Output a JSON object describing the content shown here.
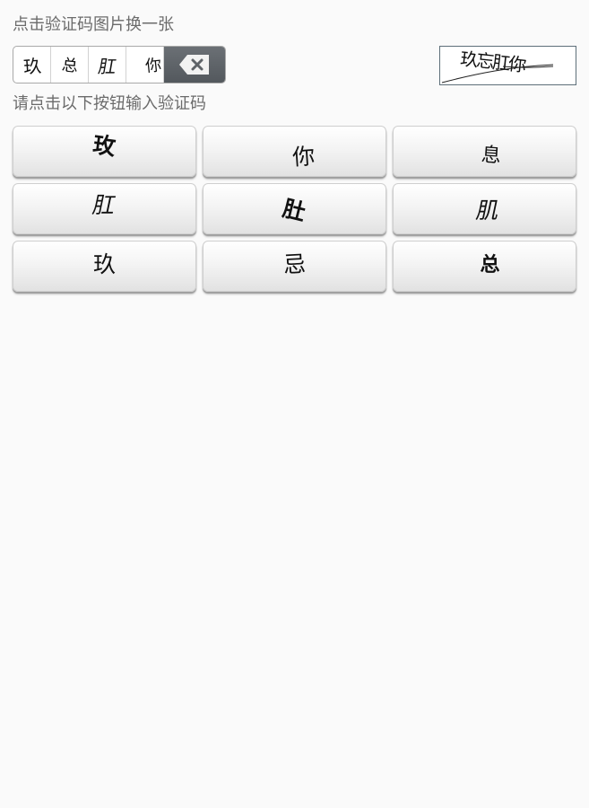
{
  "hints": {
    "refresh": "点击验证码图片换一张",
    "select": "请点击以下按钮输入验证码"
  },
  "entry": {
    "chars": [
      "玖",
      "总",
      "肛",
      "你"
    ],
    "backspace_icon": "backspace-icon"
  },
  "captcha": {
    "text": "玖忘肛你"
  },
  "keys": [
    "玫",
    "你",
    "息",
    "肛",
    "肚",
    "肌",
    "玖",
    "忌",
    "总"
  ],
  "colors": {
    "background": "#fafafa",
    "hint": "#6b6b6b",
    "backspace": "#5e6368"
  }
}
